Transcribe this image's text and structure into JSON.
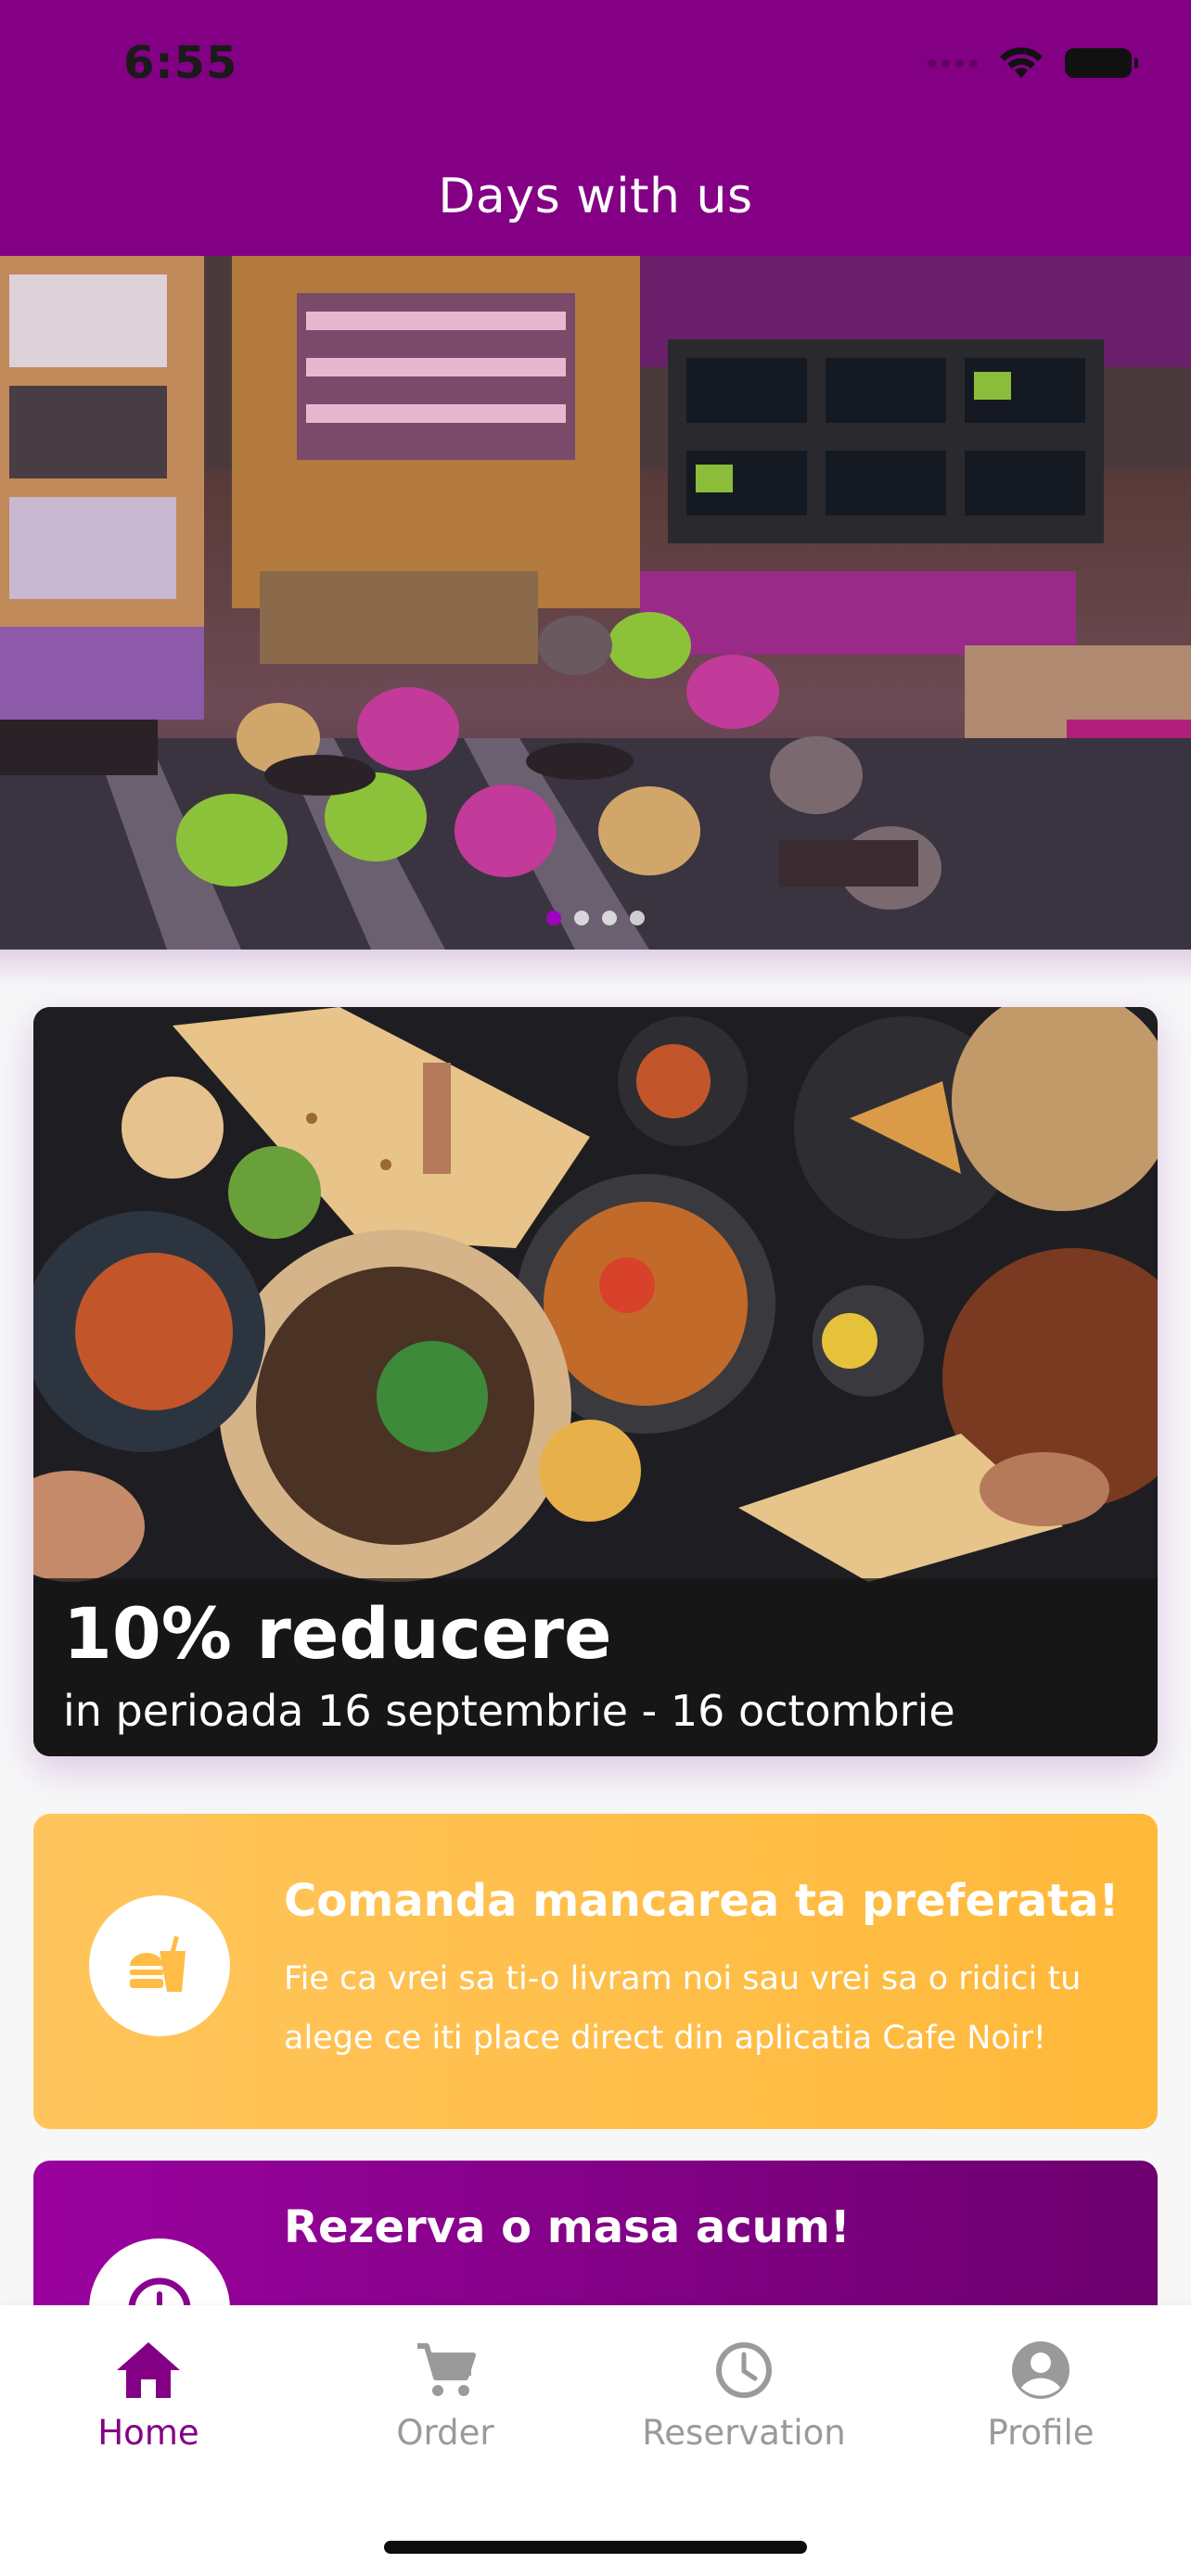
{
  "status_bar": {
    "time": "6:55"
  },
  "header": {
    "title": "Days with us"
  },
  "hero": {
    "slide_count": 4,
    "active_slide": 1
  },
  "promo": {
    "title": "10% reducere",
    "subtitle": "in perioada 16 septembrie - 16 octombrie"
  },
  "cards": [
    {
      "title": "Comanda mancarea ta preferata!",
      "description": "Fie ca vrei sa ti-o livram noi sau vrei sa o ridici tu alege ce iti place direct din aplicatia Cafe Noir!",
      "icon": "fast-food-icon"
    },
    {
      "title": "Rezerva o masa acum!",
      "description": "",
      "icon": "clock-icon"
    }
  ],
  "tabs": [
    {
      "label": "Home",
      "icon": "home-icon",
      "active": true
    },
    {
      "label": "Order",
      "icon": "cart-icon",
      "active": false
    },
    {
      "label": "Reservation",
      "icon": "clock-icon",
      "active": false
    },
    {
      "label": "Profile",
      "icon": "profile-icon",
      "active": false
    }
  ],
  "colors": {
    "brand_purple": "#830085",
    "accent_orange": "#ffb93a",
    "inactive_gray": "#9a9a9a"
  }
}
